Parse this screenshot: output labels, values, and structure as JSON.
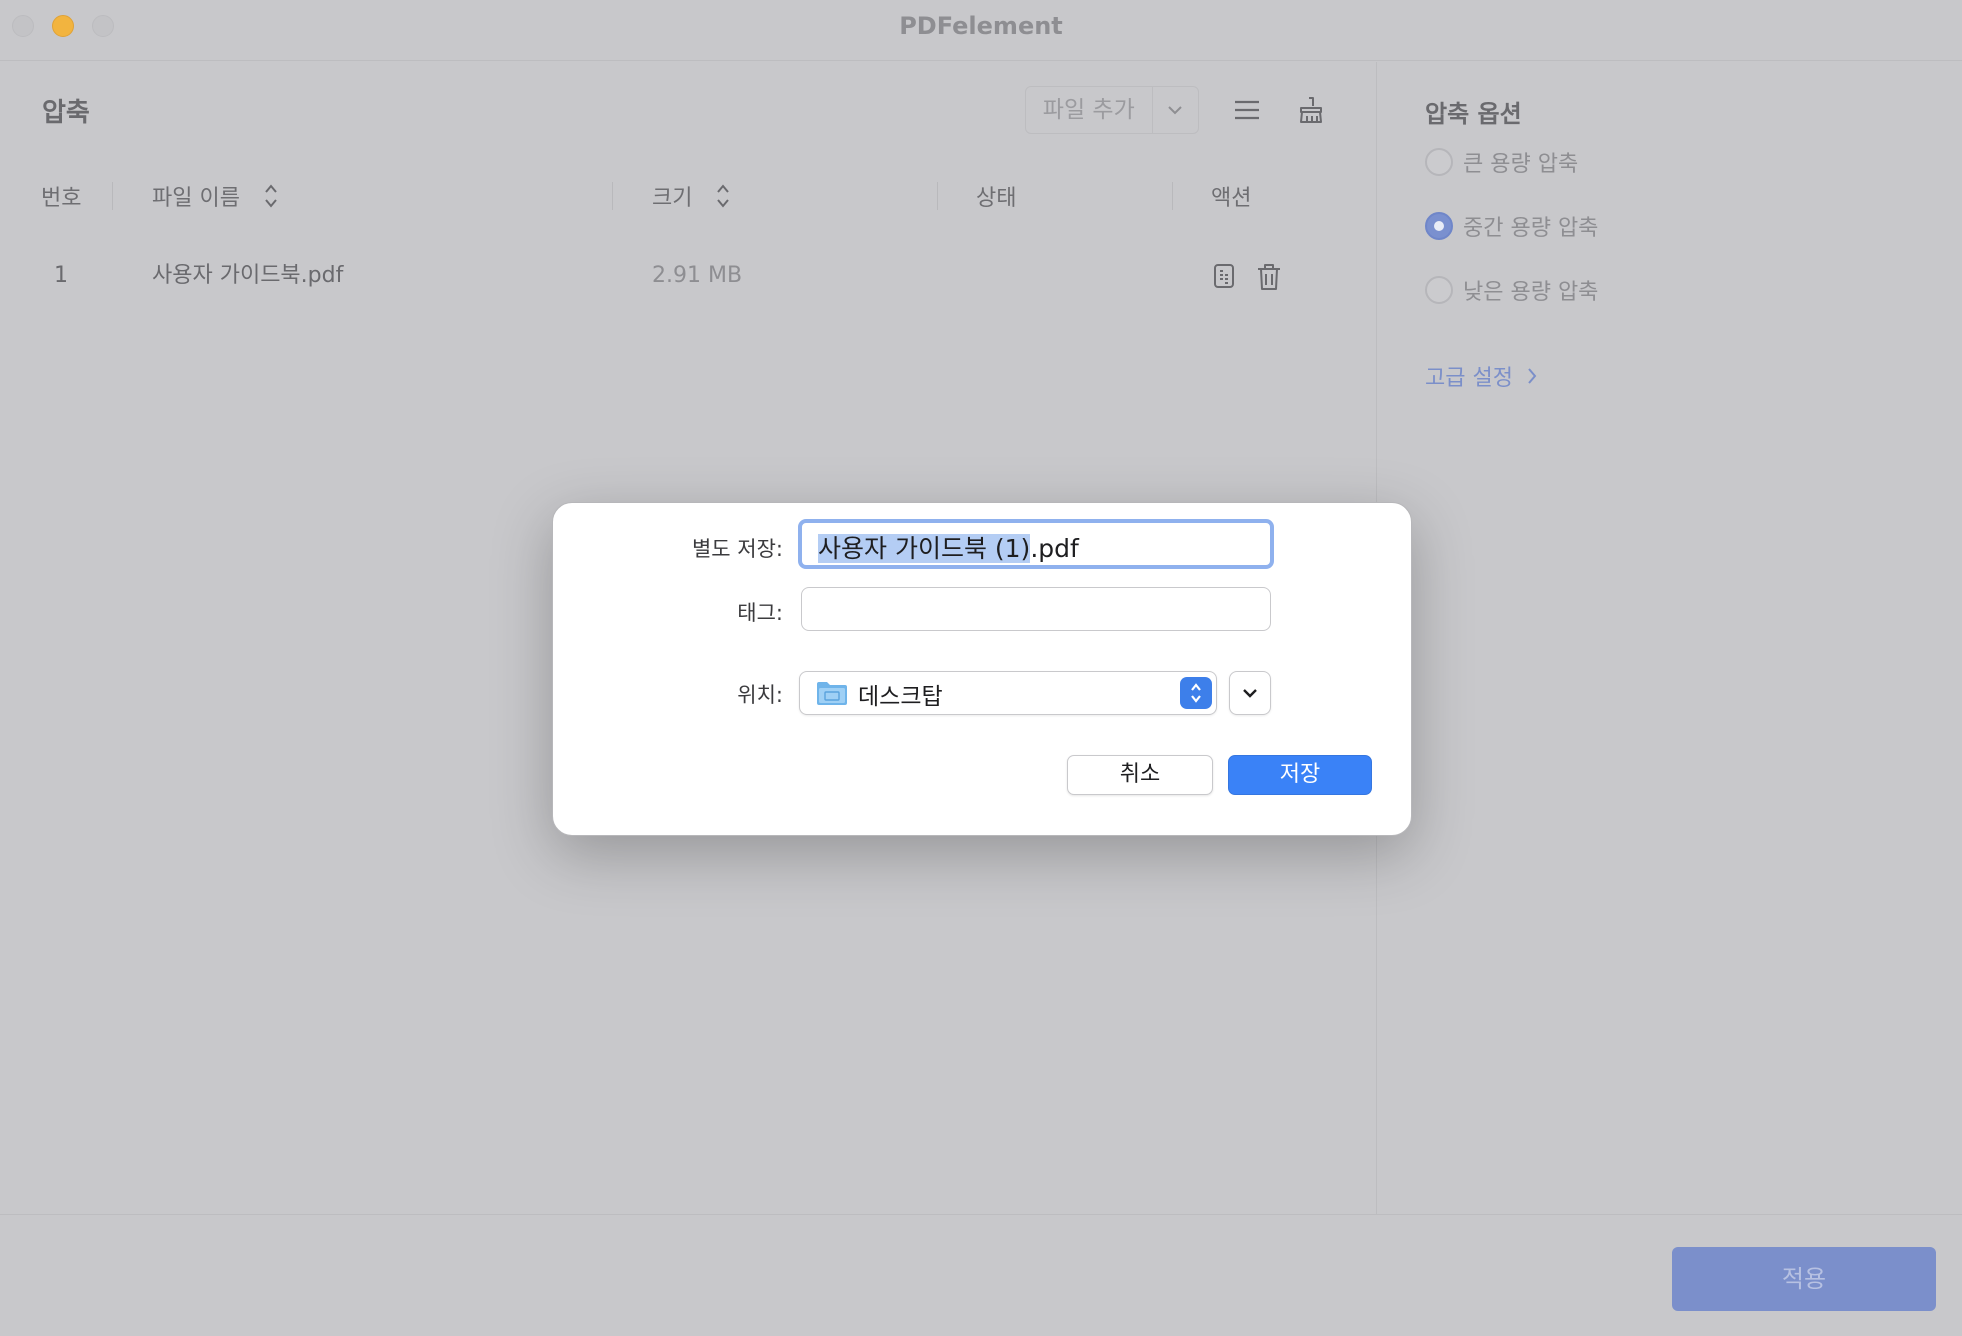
{
  "window": {
    "title": "PDFelement"
  },
  "main": {
    "section_title": "압축",
    "add_file_label": "파일 추가",
    "columns": {
      "number": "번호",
      "file_name": "파일 이름",
      "size": "크기",
      "status": "상태",
      "action": "액션"
    },
    "rows": [
      {
        "number": "1",
        "file_name": "사용자 가이드북.pdf",
        "size": "2.91 MB",
        "status": ""
      }
    ]
  },
  "side": {
    "title": "압축 옵션",
    "options": [
      {
        "label": "큰 용량 압축",
        "selected": false
      },
      {
        "label": "중간 용량 압축",
        "selected": true
      },
      {
        "label": "낮은 용량 압축",
        "selected": false
      }
    ],
    "advanced_label": "고급 설정"
  },
  "footer": {
    "apply_label": "적용"
  },
  "dialog": {
    "save_as_label": "별도 저장:",
    "filename_selected": "사용자 가이드북 (1)",
    "filename_ext": ".pdf",
    "tags_label": "태그:",
    "tags_value": "",
    "location_label": "위치:",
    "location_value": "데스크탑",
    "cancel_label": "취소",
    "save_label": "저장"
  },
  "colors": {
    "accent": "#3a82f7",
    "apply": "#7b8fcb",
    "radio_on": "#7a90cf",
    "minimize": "#f2b43f"
  }
}
